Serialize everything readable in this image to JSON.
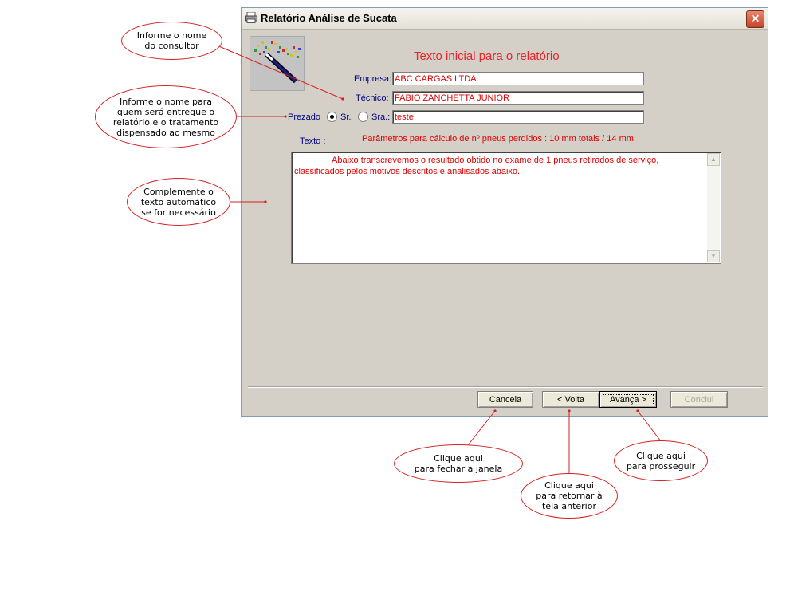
{
  "window": {
    "title": "Relatório Análise de Sucata",
    "close_label": "✕"
  },
  "form": {
    "heading": "Texto inicial para o relatório",
    "empresa_label": "Empresa:",
    "empresa_value": "ABC CARGAS LTDA.",
    "tecnico_label": "Técnico:",
    "tecnico_value": "FABIO ZANCHETTA JUNIOR",
    "prezado_label": "Prezado",
    "sr_label": "Sr.",
    "sra_label": "Sra.:",
    "selected_salutation": "Sr.",
    "prezado_value": "teste",
    "texto_label": "Texto :",
    "params_text": "Parâmetros para cálculo de nº pneus perdidos : 10 mm totais / 14 mm.",
    "texto_value": "Abaixo transcrevemos o resultado obtido no exame de 1 pneus retirados de serviço, classificados pelos motivos descritos e analisados abaixo."
  },
  "buttons": {
    "cancela": "Cancela",
    "volta": "< Volta",
    "avanca": "Avança >",
    "conclui": "Conclui"
  },
  "annotations": {
    "consultor": "Informe o nome\ndo consultor",
    "entregue": "Informe o nome para\nquem será entregue o\nrelatório e o tratamento\ndispensado ao mesmo",
    "complemente": "Complemente o\ntexto automático\nse for necessário",
    "fechar": "Clique aqui\npara fechar a janela",
    "retornar": "Clique aqui\npara retornar à\ntela anterior",
    "prosseguir": "Clique aqui\npara prosseguir"
  },
  "colors": {
    "accent_red": "#e8232a",
    "label_navy": "#000080",
    "window_bg": "#d4d0c8"
  }
}
